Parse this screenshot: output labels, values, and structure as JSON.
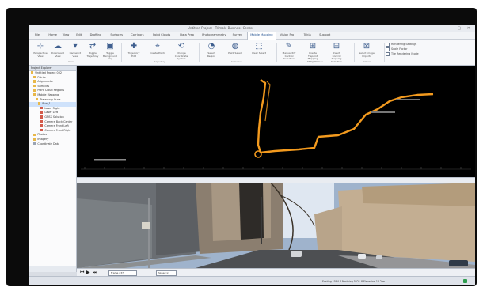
{
  "window": {
    "title": "Untitled Project - Trimble Business Center"
  },
  "menu_tabs": [
    "File",
    "Home",
    "View",
    "Edit",
    "Drafting",
    "Surfaces",
    "Corridors",
    "Point Clouds",
    "Data Prep",
    "Photogrammetry",
    "Survey",
    "Mobile Mapping",
    "Vision Pro",
    "Tekla",
    "Support"
  ],
  "active_tab": "Mobile Mapping",
  "ribbon": {
    "groups": [
      {
        "label": "View",
        "buttons": [
          "Perspective View",
          "Downward View",
          "Backward View",
          "Toggle Trajectory",
          "Toggle Background Img"
        ]
      },
      {
        "label": "Trajectory",
        "buttons": [
          "Trajectory Edit",
          "Create Points",
          "Change Coordinate System"
        ]
      },
      {
        "label": "Selection",
        "buttons": [
          "Select Region",
          "Paint Select",
          "Clear Select"
        ]
      },
      {
        "label": "Registration",
        "buttons": [
          "Manual RIT Control Selection",
          "Create Tiepoint Mapping Selection",
          "Insert Control Mapping Selection"
        ]
      },
      {
        "label": "Extract",
        "buttons": [
          "Select Image Imports"
        ]
      }
    ],
    "options": [
      "Rendering Settings",
      "Scale Factor",
      "Tile Rendering Mode"
    ]
  },
  "project_explorer": {
    "title": "Project Explorer",
    "items": [
      {
        "label": "Untitled Project 002",
        "depth": 0,
        "kind": "folder"
      },
      {
        "label": "Points",
        "depth": 1,
        "kind": "folder"
      },
      {
        "label": "Alignments",
        "depth": 1,
        "kind": "folder"
      },
      {
        "label": "Surfaces",
        "depth": 1,
        "kind": "folder"
      },
      {
        "label": "Point Cloud Regions",
        "depth": 1,
        "kind": "folder"
      },
      {
        "label": "Mobile Mapping",
        "depth": 1,
        "kind": "folder"
      },
      {
        "label": "Trajectory Runs",
        "depth": 2,
        "kind": "folder"
      },
      {
        "label": "Run_1",
        "depth": 3,
        "kind": "folder",
        "selected": true
      },
      {
        "label": "Laser Right",
        "depth": 4,
        "kind": "red"
      },
      {
        "label": "Laser Left",
        "depth": 4,
        "kind": "red"
      },
      {
        "label": "GNSS Solution",
        "depth": 4,
        "kind": "red"
      },
      {
        "label": "Camera Back Center",
        "depth": 4,
        "kind": "red"
      },
      {
        "label": "Camera Front Left",
        "depth": 4,
        "kind": "red"
      },
      {
        "label": "Camera Front Right",
        "depth": 4,
        "kind": "red"
      },
      {
        "label": "Photos",
        "depth": 1,
        "kind": "folder"
      },
      {
        "label": "Imagery",
        "depth": 1,
        "kind": "folder"
      },
      {
        "label": "Coordinate Data",
        "depth": 1,
        "kind": "gray"
      }
    ],
    "bottom_tabs": [
      "Project Explorer",
      "View Filter Manager"
    ]
  },
  "viewer": {
    "mode_label": "Plan View"
  },
  "image_pane": {
    "header": "Run_1, Camera Back Center, Station 2347 (Lat: 37.78, Lon: -122.40)"
  },
  "playback": {
    "frame_field": "Frame 237",
    "speed_field": "Speed x1"
  },
  "status": {
    "left": "",
    "coords": "Easting  1584.4    Northing  5521.8    Elevation  18.2 m"
  },
  "colors": {
    "trajectory": "#f39a1e",
    "background": "#000000",
    "accent": "#1f4f8f"
  }
}
